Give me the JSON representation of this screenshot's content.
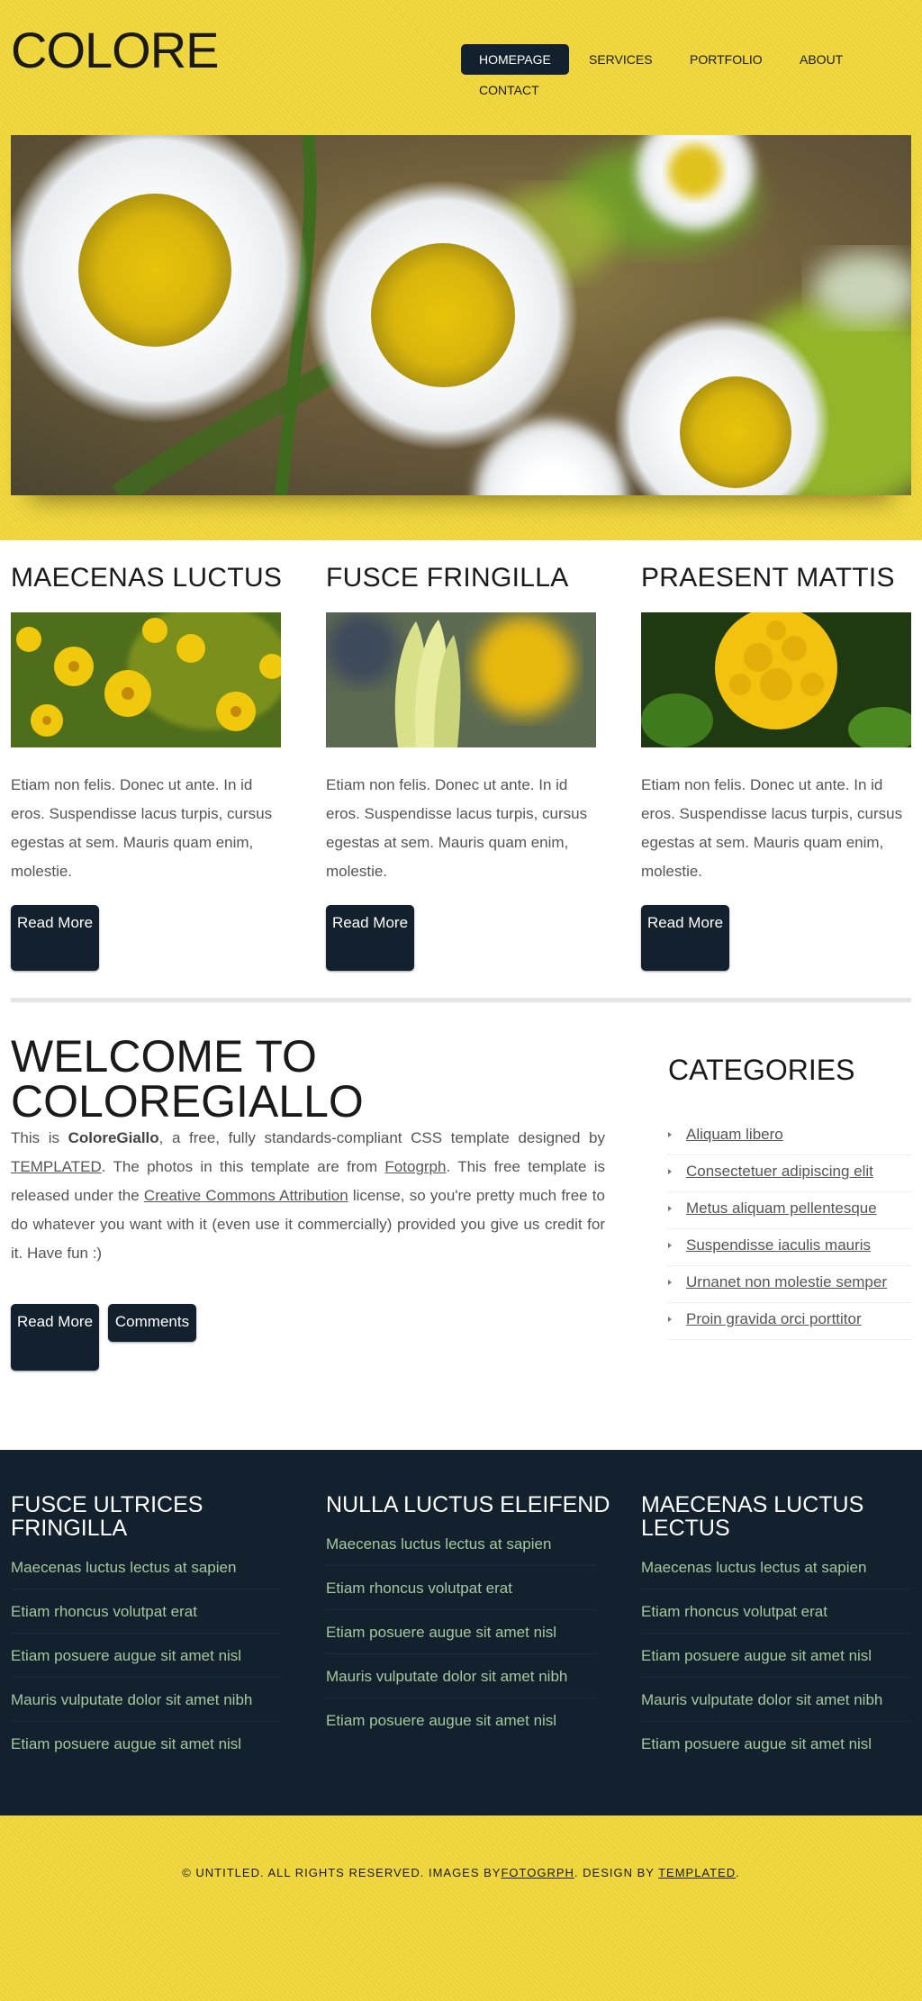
{
  "header": {
    "logo": "COLORE",
    "nav": [
      "HOMEPAGE",
      "SERVICES",
      "PORTFOLIO",
      "ABOUT",
      "CONTACT"
    ],
    "active_nav": "HOMEPAGE"
  },
  "features": [
    {
      "title": "MAECENAS LUCTUS",
      "text": "Etiam non felis. Donec ut ante. In id eros. Suspendisse lacus turpis, cursus egestas at sem. Mauris quam enim, molestie.",
      "button": "Read More"
    },
    {
      "title": "FUSCE FRINGILLA",
      "text": "Etiam non felis. Donec ut ante. In id eros. Suspendisse lacus turpis, cursus egestas at sem. Mauris quam enim, molestie.",
      "button": "Read More"
    },
    {
      "title": "PRAESENT MATTIS",
      "text": "Etiam non felis. Donec ut ante. In id eros. Suspendisse lacus turpis, cursus egestas at sem. Mauris quam enim, molestie.",
      "button": "Read More"
    }
  ],
  "welcome": {
    "title_line1": "WELCOME TO",
    "title_line2": "COLOREGIALLO",
    "text_1": "This is ",
    "text_bold": "ColoreGiallo",
    "text_2": ", a free, fully standards-compliant CSS template designed by ",
    "link_templated": "TEMPLATED",
    "text_3": ". The photos in this template are from ",
    "link_fotogrph": "Fotogrph",
    "text_4": ". This free template is released under the ",
    "link_license": "Creative Commons Attribution",
    "text_5": " license, so you're pretty much free to do whatever you want with it (even use it commercially) provided you give us credit for it. Have fun :)",
    "read_more": "Read More",
    "comments": "Comments"
  },
  "categories": {
    "title": "CATEGORIES",
    "items": [
      "Aliquam libero",
      "Consectetuer adipiscing elit",
      "Metus aliquam pellentesque",
      "Suspendisse iaculis mauris",
      "Urnanet non molestie semper",
      "Proin gravida orci porttitor"
    ]
  },
  "footer_columns": [
    {
      "title": "FUSCE ULTRICES FRINGILLA",
      "items": [
        "Maecenas luctus lectus at sapien",
        "Etiam rhoncus volutpat erat",
        "Etiam posuere augue sit amet nisl",
        "Mauris vulputate dolor sit amet nibh",
        "Etiam posuere augue sit amet nisl"
      ]
    },
    {
      "title": "NULLA LUCTUS ELEIFEND",
      "items": [
        "Maecenas luctus lectus at sapien",
        "Etiam rhoncus volutpat erat",
        "Etiam posuere augue sit amet nisl",
        "Mauris vulputate dolor sit amet nibh",
        "Etiam posuere augue sit amet nisl"
      ]
    },
    {
      "title": "MAECENAS LUCTUS LECTUS",
      "items": [
        "Maecenas luctus lectus at sapien",
        "Etiam rhoncus volutpat erat",
        "Etiam posuere augue sit amet nisl",
        "Mauris vulputate dolor sit amet nibh",
        "Etiam posuere augue sit amet nisl"
      ]
    }
  ],
  "copyright": {
    "text_1": "© UNTITLED. ALL RIGHTS RESERVED. IMAGES BY",
    "link_1": "FOTOGRPH",
    "text_2": ". DESIGN BY ",
    "link_2": "TEMPLATED",
    "text_3": "."
  },
  "colors": {
    "brand_yellow": "#f1d73a",
    "navy": "#13202e",
    "footer_link_green": "#a6c89c"
  },
  "icons": [
    "flower-photo",
    "bullet-arrow-icon"
  ]
}
